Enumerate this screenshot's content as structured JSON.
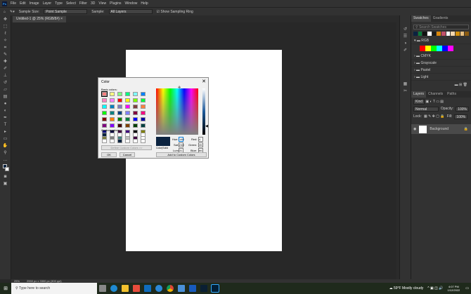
{
  "menu": [
    "File",
    "Edit",
    "Image",
    "Layer",
    "Type",
    "Select",
    "Filter",
    "3D",
    "View",
    "Plugins",
    "Window",
    "Help"
  ],
  "options": {
    "sample_size_label": "Sample Size:",
    "sample_size": "Point Sample",
    "sample_label": "Sample:",
    "sample": "All Layers",
    "show_ring": "Show Sampling Ring"
  },
  "doc_tab": "Untitled-1 @ 25% (RGB/8#) ×",
  "status": {
    "zoom": "25%",
    "info": "2550 px x 3300 px (300 ppi)"
  },
  "panels": {
    "tabs": [
      "Swatches",
      "Gradients"
    ],
    "search_placeholder": "Search Swatches",
    "recent": [
      "#0b2340",
      "#0a7a3a",
      "#111111",
      "#ffffff",
      "#1a1a1a",
      "#d9860a",
      "#c0506a",
      "#ffffff",
      "#f5d8b0",
      "#d4900a",
      "#e8c080",
      "#8a5a10"
    ],
    "folders": [
      {
        "name": "RGB",
        "colors": [
          "#ff0000",
          "#ffff00",
          "#00ff00",
          "#00ffff",
          "#0000ff",
          "#ff00ff"
        ]
      },
      {
        "name": "CMYK"
      },
      {
        "name": "Grayscale"
      },
      {
        "name": "Pastel"
      },
      {
        "name": "Light"
      }
    ],
    "layer_tabs": [
      "Layers",
      "Channels",
      "Paths"
    ],
    "kind": "Kind",
    "blend": "Normal",
    "opacity_label": "Opacity:",
    "opacity": "100%",
    "lock_label": "Lock:",
    "fill_label": "Fill:",
    "fill": "100%",
    "layer_name": "Background"
  },
  "dialog": {
    "title": "Color",
    "basic_label": "Basic colors:",
    "custom_label": "Custom colors:",
    "define_btn": "Define Custom Colors >>",
    "ok": "OK",
    "cancel": "Cancel",
    "add_btn": "Add to Custom Colors",
    "solid_label": "Color|Solid",
    "hue_label": "Hue:",
    "hue": "140",
    "sat_label": "Sat:",
    "sat": "240",
    "lum_label": "Lum:",
    "lum": "31",
    "red_label": "Red:",
    "red": "4",
    "green_label": "Green:",
    "green": "35",
    "blue_label": "Blue:",
    "blue": "66",
    "current": "#0b2340",
    "basic": [
      "#ff8080",
      "#ffff80",
      "#80ff80",
      "#00ff80",
      "#80ffff",
      "#0080ff",
      "#ff80c0",
      "#ff80ff",
      "#ff0000",
      "#ffff00",
      "#80ff00",
      "#00ff40",
      "#00ffff",
      "#0080c0",
      "#8080c0",
      "#ff00ff",
      "#804040",
      "#ff8040",
      "#00ff00",
      "#008080",
      "#004080",
      "#8080ff",
      "#800040",
      "#ff0080",
      "#800000",
      "#ff8000",
      "#008000",
      "#008040",
      "#0000ff",
      "#0000a0",
      "#800080",
      "#8000ff",
      "#400000",
      "#804000",
      "#004000",
      "#004040",
      "#000080",
      "#000040",
      "#400040",
      "#400080",
      "#000000",
      "#808000",
      "#808040",
      "#808080",
      "#408080",
      "#c0c0c0",
      "#400040",
      "#ffffff"
    ],
    "custom": [
      "#0b2340",
      "#ffffff",
      "#ffffff",
      "#ffffff",
      "#ffffff",
      "#ffffff",
      "#ffffff",
      "#ffffff",
      "#0b2340",
      "#ffffff",
      "#ffffff",
      "#ffffff",
      "#ffffff",
      "#ffffff",
      "#ffffff",
      "#ffffff"
    ]
  },
  "taskbar": {
    "search": "Type here to search",
    "weather": "59°F Mostly cloudy",
    "time": "4:07 PM",
    "date": "1/12/2022"
  }
}
